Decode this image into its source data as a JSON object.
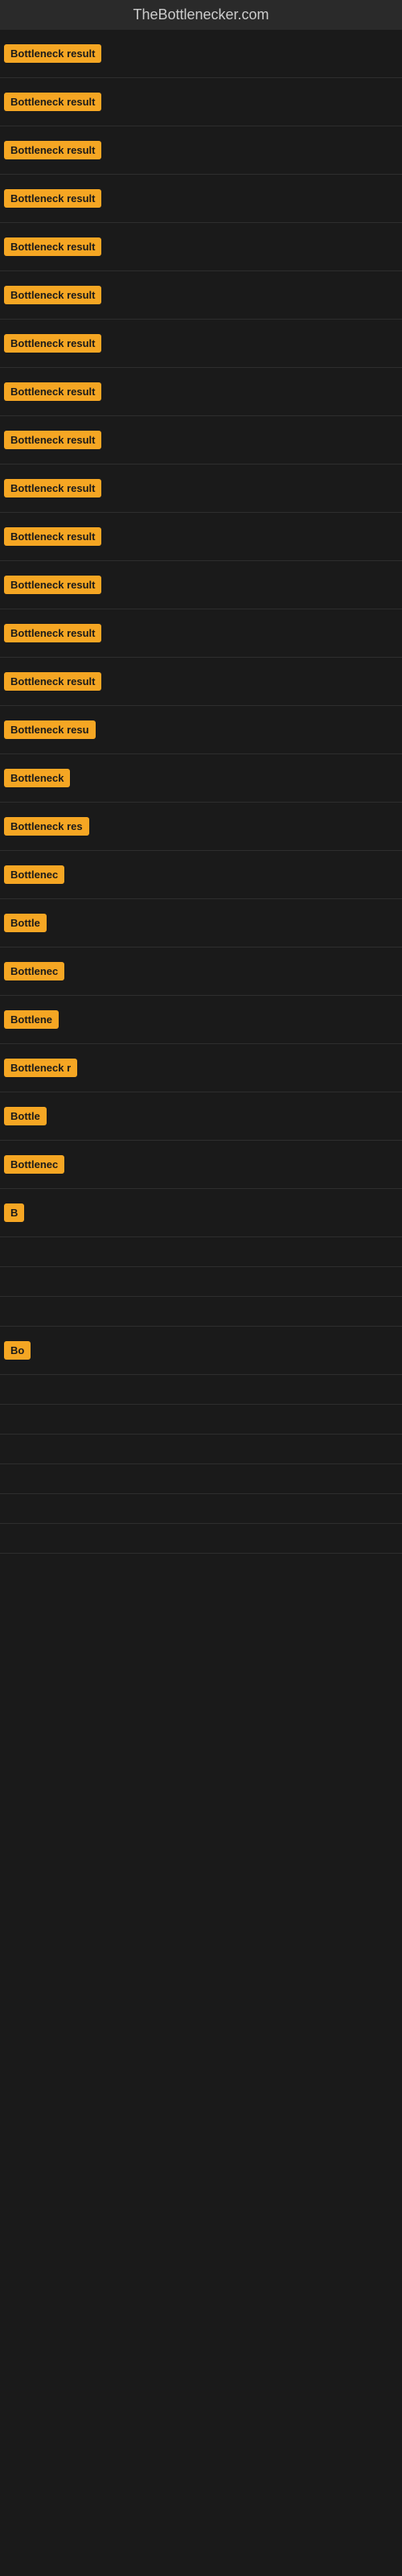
{
  "site": {
    "title": "TheBottlenecker.com"
  },
  "colors": {
    "badge_bg": "#f5a623",
    "page_bg": "#1a1a1a"
  },
  "items": [
    {
      "label": "Bottleneck result",
      "visible_chars": 16
    },
    {
      "label": "Bottleneck result",
      "visible_chars": 16
    },
    {
      "label": "Bottleneck result",
      "visible_chars": 16
    },
    {
      "label": "Bottleneck result",
      "visible_chars": 16
    },
    {
      "label": "Bottleneck result",
      "visible_chars": 16
    },
    {
      "label": "Bottleneck result",
      "visible_chars": 16
    },
    {
      "label": "Bottleneck result",
      "visible_chars": 16
    },
    {
      "label": "Bottleneck result",
      "visible_chars": 16
    },
    {
      "label": "Bottleneck result",
      "visible_chars": 16
    },
    {
      "label": "Bottleneck result",
      "visible_chars": 16
    },
    {
      "label": "Bottleneck result",
      "visible_chars": 16
    },
    {
      "label": "Bottleneck result",
      "visible_chars": 16
    },
    {
      "label": "Bottleneck result",
      "visible_chars": 16
    },
    {
      "label": "Bottleneck result",
      "visible_chars": 16
    },
    {
      "label": "Bottleneck resu",
      "visible_chars": 15
    },
    {
      "label": "Bottleneck",
      "visible_chars": 10
    },
    {
      "label": "Bottleneck res",
      "visible_chars": 14
    },
    {
      "label": "Bottlenec",
      "visible_chars": 9
    },
    {
      "label": "Bottle",
      "visible_chars": 6
    },
    {
      "label": "Bottlenec",
      "visible_chars": 9
    },
    {
      "label": "Bottlene",
      "visible_chars": 8
    },
    {
      "label": "Bottleneck r",
      "visible_chars": 12
    },
    {
      "label": "Bottle",
      "visible_chars": 6
    },
    {
      "label": "Bottlenec",
      "visible_chars": 9
    },
    {
      "label": "B",
      "visible_chars": 1
    },
    {
      "label": "",
      "visible_chars": 0
    },
    {
      "label": "",
      "visible_chars": 0
    },
    {
      "label": "",
      "visible_chars": 0
    },
    {
      "label": "Bo",
      "visible_chars": 2
    },
    {
      "label": "",
      "visible_chars": 0
    },
    {
      "label": "",
      "visible_chars": 0
    },
    {
      "label": "",
      "visible_chars": 0
    },
    {
      "label": "",
      "visible_chars": 0
    },
    {
      "label": "",
      "visible_chars": 0
    },
    {
      "label": "",
      "visible_chars": 0
    }
  ]
}
